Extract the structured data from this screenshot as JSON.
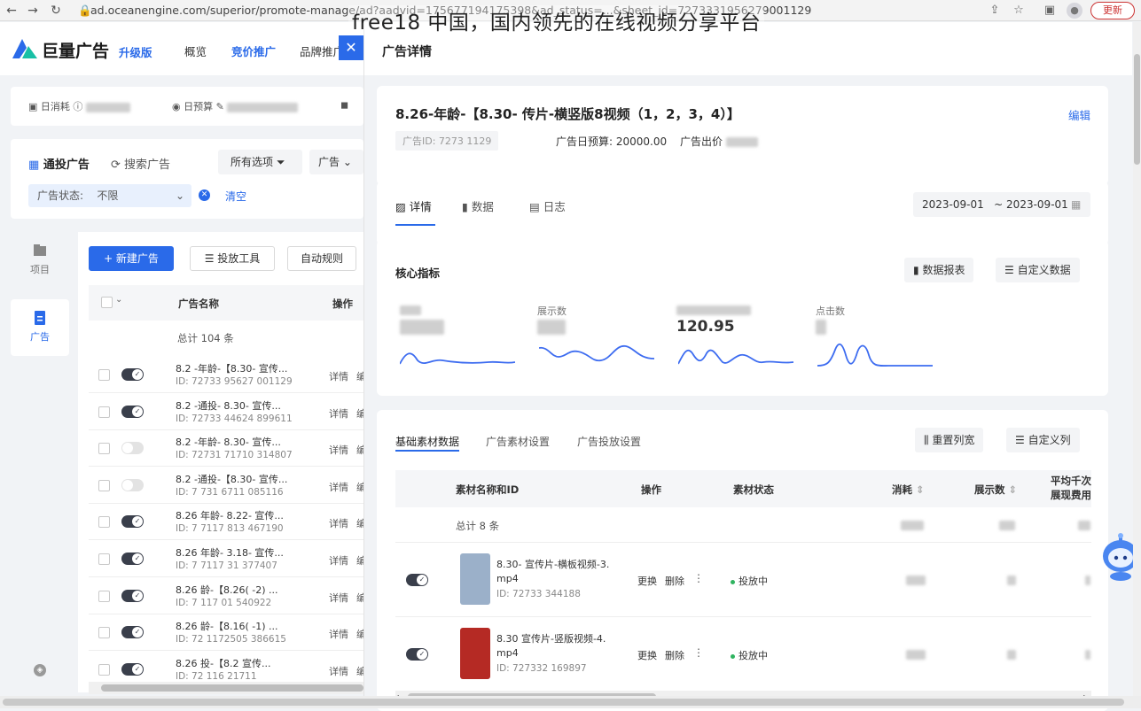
{
  "browser": {
    "url": "ad.oceanengine.com/superior/promote-manage/ad?aadvid=175677194175398&ad_status=...&sheet_id=7273331956279001129",
    "update_label": "更新"
  },
  "overlay_title": "free18 中国，国内领先的在线视频分享平台",
  "app": {
    "brand": "巨量广告",
    "edition": "升级版",
    "nav": [
      "概览",
      "竞价推广",
      "品牌推广"
    ],
    "budget": {
      "daily_cost": "日消耗",
      "daily_budget": "日预算"
    },
    "filters": {
      "tab_all": "通投广告",
      "tab_search": "搜索广告",
      "all_options": "所有选项",
      "ad_dropdown": "广告",
      "status_label": "广告状态:",
      "status_value": "不限",
      "clear": "清空"
    },
    "sidebar": [
      {
        "label": "项目"
      },
      {
        "label": "广告"
      }
    ],
    "toolbar": {
      "new_ad": "+ 新建广告",
      "tools": "投放工具",
      "auto_rules": "自动规则"
    },
    "table": {
      "col_name": "广告名称",
      "col_action": "操作",
      "total": "总计 104 条",
      "detail_label": "详情",
      "rows": [
        {
          "name": "8.2  -年龄-【8.30-  宣传...",
          "id": "ID: 72733   95627   001129",
          "on": true
        },
        {
          "name": "8.2  -通投-  8.30-  宣传...",
          "id": "ID: 72733   44624   899611",
          "on": true
        },
        {
          "name": "8.2  -年龄-  8.30-  宣传...",
          "id": "ID: 72731   71710   314807",
          "on": false
        },
        {
          "name": "8.2  -通投-【8.30-  宣传...",
          "id": "ID: 7  731   6711   085116",
          "on": false
        },
        {
          "name": "8.26  年龄-  8.22-  宣传...",
          "id": "ID: 7  7117   813   467190",
          "on": true
        },
        {
          "name": "8.26  年龄-  3.18-  宣传...",
          "id": "ID: 7  7117   31    377407",
          "on": true
        },
        {
          "name": "8.26  龄-【8.26(  -2) ...",
          "id": "ID: 7  117   01    540922",
          "on": true
        },
        {
          "name": "8.26  龄-【8.16(  -1) ...",
          "id": "ID: 72  1172505   386615",
          "on": true
        },
        {
          "name": "8.26  投-【8.2   宣传...",
          "id": "ID: 72  116   21711",
          "on": true
        }
      ]
    }
  },
  "drawer": {
    "title": "广告详情",
    "ad_title": "8.26-年龄-【8.30-  传片-横竖版8视频（1，2，3，4）】",
    "edit": "编辑",
    "ad_id": "广告ID: 7273       1129",
    "daily_budget": "广告日预算: 20000.00",
    "bid": "广告出价",
    "tabs": [
      "详情",
      "数据",
      "日志"
    ],
    "date_range": "2023-09-01   ~ 2023-09-01",
    "core_metrics": "核心指标",
    "data_report": "数据报表",
    "custom_data": "自定义数据",
    "metrics": [
      {
        "label": "",
        "value": ""
      },
      {
        "label": "展示数",
        "value": ""
      },
      {
        "label": "",
        "value": "120.95"
      },
      {
        "label": "点击数",
        "value": ""
      }
    ],
    "material_tabs": [
      "基础素材数据",
      "广告素材设置",
      "广告投放设置"
    ],
    "reset_cols": "重置列宽",
    "custom_cols": "自定义列",
    "material_table": {
      "col_name": "素材名称和ID",
      "col_action": "操作",
      "col_status": "素材状态",
      "col_cost": "消耗",
      "col_impr": "展示数",
      "col_cpm": "平均千次展现费用",
      "total": "总计 8 条",
      "rows": [
        {
          "name": "8.30-  宣传片-横板视频-3.",
          "ext": "mp4",
          "id": "ID: 72733       344188",
          "replace": "更换",
          "delete": "删除",
          "status": "投放中"
        },
        {
          "name": "8.30   宣传片-竖版视频-4.",
          "ext": "mp4",
          "id": "ID: 727332      169897",
          "replace": "更换",
          "delete": "删除",
          "status": "投放中"
        }
      ]
    }
  }
}
